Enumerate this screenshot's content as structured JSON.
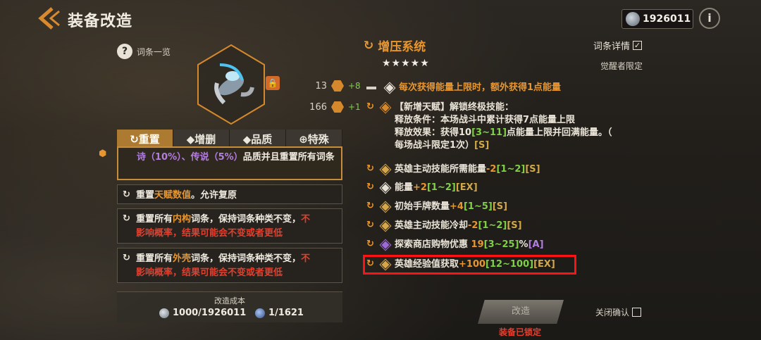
{
  "header": {
    "back_icon": "back-arrow-icon",
    "title": "装备改造",
    "currency_value": "1926011",
    "info_label": "i"
  },
  "left": {
    "entry_list_label": "词条一览",
    "help_label": "?",
    "stats": [
      {
        "value": "13",
        "delta": "+8"
      },
      {
        "value": "166",
        "delta": "+1"
      }
    ],
    "tabs": [
      {
        "label": "重置",
        "icon": "↻"
      },
      {
        "label": "增删",
        "icon": "◆"
      },
      {
        "label": "品质",
        "icon": "◆"
      },
      {
        "label": "特殊",
        "icon": "⊕"
      }
    ],
    "active_tab": 0,
    "options": {
      "opt1_part1": "诗（10%）、传说（5%）",
      "opt1_part2": "品质并且重置所有词条",
      "opt2_prefix": "重置",
      "opt2_highlight": "天赋数值",
      "opt2_suffix": "。允许复原",
      "opt3_prefix": "重置所有",
      "opt3_highlight": "内构",
      "opt3_mid": "词条，保持词条种类不变，",
      "opt3_red1": "不",
      "opt3_red2": "影响概率，结果可能会不变或者更低",
      "opt4_prefix": "重置所有",
      "opt4_highlight": "外壳",
      "opt4_mid": "词条，保持词条种类不变，",
      "opt4_red1": "不",
      "opt4_red2": "影响概率，结果可能会不变或者更低"
    },
    "cost": {
      "label": "改造成本",
      "gold": "1000/1926011",
      "core": "1/1621"
    }
  },
  "right": {
    "system_title": "增压系统",
    "stars": "★★★★★",
    "detail_label": "词条详情",
    "detail_checked": "✓",
    "awakened_label": "觉醒者限定",
    "first_entry": "每次获得能量上限时，额外获得1点能量",
    "talent_title": "【新增天赋】解锁终极技能：",
    "talent_line1": "释放条件：本场战斗中累计获得7点能量上限",
    "talent_line2_a": "释放效果：获得10",
    "talent_line2_b": "[3~11]",
    "talent_line2_c": "点能量上限并回满能量。（",
    "talent_line3_a": "每场战斗限定1次）",
    "talent_line3_b": "[S]",
    "entries": [
      {
        "label": "英雄主动技能所需能量",
        "value": "-2",
        "range": "[1~2]",
        "tier": "[S]"
      },
      {
        "label": "能量",
        "value": "+2",
        "range": "[1~2]",
        "tier": "[EX]"
      },
      {
        "label": "初始手牌数量",
        "value": "+4",
        "range": "[1~5]",
        "tier": "[S]"
      },
      {
        "label": "英雄主动技能冷却",
        "value": "-2",
        "range": "[1~2]",
        "tier": "[S]"
      },
      {
        "label": "探索商店购物优惠 ",
        "value": "19",
        "range": "[3~25]",
        "unit": "%",
        "tier": "[A]"
      },
      {
        "label": "英雄经验值获取",
        "value": "+100",
        "range": "[12~100]",
        "tier": "[EX]"
      }
    ],
    "modify_label": "改造",
    "locked_label": "装备已锁定",
    "close_confirm_label": "关闭确认"
  }
}
